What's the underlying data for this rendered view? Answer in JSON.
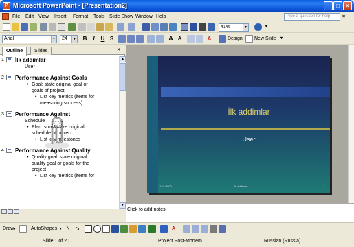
{
  "window": {
    "title": "Microsoft PowerPoint - [Presentation2]",
    "app_icon": "P"
  },
  "menu": [
    "File",
    "Edit",
    "View",
    "Insert",
    "Format",
    "Tools",
    "Slide Show",
    "Window",
    "Help"
  ],
  "help_placeholder": "Type a question for help",
  "toolbar": {
    "zoom": "41%",
    "font": "Arial",
    "font_size": "24",
    "bold": "B",
    "italic": "I",
    "underline": "U",
    "shadow": "S",
    "design": "Design",
    "new_slide": "New Slide"
  },
  "panel": {
    "tabs": [
      "Outline",
      "Slides"
    ],
    "close": "×"
  },
  "outline": [
    {
      "num": "1",
      "title": "İlk addimlar",
      "subtitle": "User",
      "bullets": []
    },
    {
      "num": "2",
      "title": "Performance Against Goals",
      "subtitle": "",
      "bullets": [
        {
          "level": 1,
          "text": "Goal: state original goal or"
        },
        {
          "level": 1,
          "text": "goals of project",
          "cont": true
        },
        {
          "level": 2,
          "text": "List key metrics (items for"
        },
        {
          "level": 2,
          "text": "measuring success)",
          "cont": true
        }
      ]
    },
    {
      "num": "3",
      "title": "Performance Against",
      "subtitle": "Schedule",
      "bullets": [
        {
          "level": 1,
          "text": "Plan: summarize original"
        },
        {
          "level": 1,
          "text": "schedule of project",
          "cont": true
        },
        {
          "level": 2,
          "text": "List key milestones"
        }
      ]
    },
    {
      "num": "4",
      "title": "Performance Against Quality",
      "subtitle": "",
      "bullets": [
        {
          "level": 1,
          "text": "Quality goal: state original"
        },
        {
          "level": 1,
          "text": "quality goal or goals for the",
          "cont": true
        },
        {
          "level": 1,
          "text": "project",
          "cont": true
        },
        {
          "level": 2,
          "text": "List key metrics (items for"
        }
      ]
    }
  ],
  "slide": {
    "title": "İlk addimlar",
    "subtitle": "User",
    "footer_date": "12/1/2002",
    "footer_mid": "İlk addimlar",
    "footer_num": "1"
  },
  "notes_placeholder": "Click to add notes",
  "draw": {
    "draw_label": "Draw",
    "autoshapes": "AutoShapes"
  },
  "status": {
    "slide": "Slide 1 of 20",
    "template": "Project Post-Mortem",
    "language": "Russian (Russia)"
  },
  "colors": {
    "title_bar": "#0a5fe0",
    "slide_title": "#d9cf70",
    "slide_bg": "#1d3a6a"
  }
}
